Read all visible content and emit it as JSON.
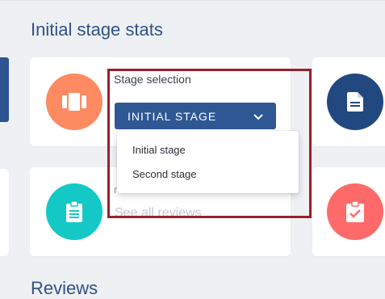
{
  "section": {
    "title": "Initial stage stats",
    "next_title": "Reviews"
  },
  "stage_card": {
    "label": "Stage selection",
    "selected": "INITIAL STAGE",
    "icon": "film-strip-icon",
    "icon_color": "#fe8a62"
  },
  "dropdown": {
    "options": [
      "Initial stage",
      "Second stage"
    ]
  },
  "reviews_card": {
    "partial_label": "reviews",
    "link": "See all reviews",
    "icon": "clipboard-list-icon",
    "icon_color": "#14c8c6"
  },
  "right_cards": {
    "document_icon": "document-icon",
    "document_color": "#22497f",
    "check_icon": "clipboard-check-icon",
    "check_color": "#fe6a6a"
  },
  "colors": {
    "primary": "#2f5794",
    "title": "#2f5287",
    "highlight_border": "#9a1f2b",
    "background": "#eef0f4"
  }
}
